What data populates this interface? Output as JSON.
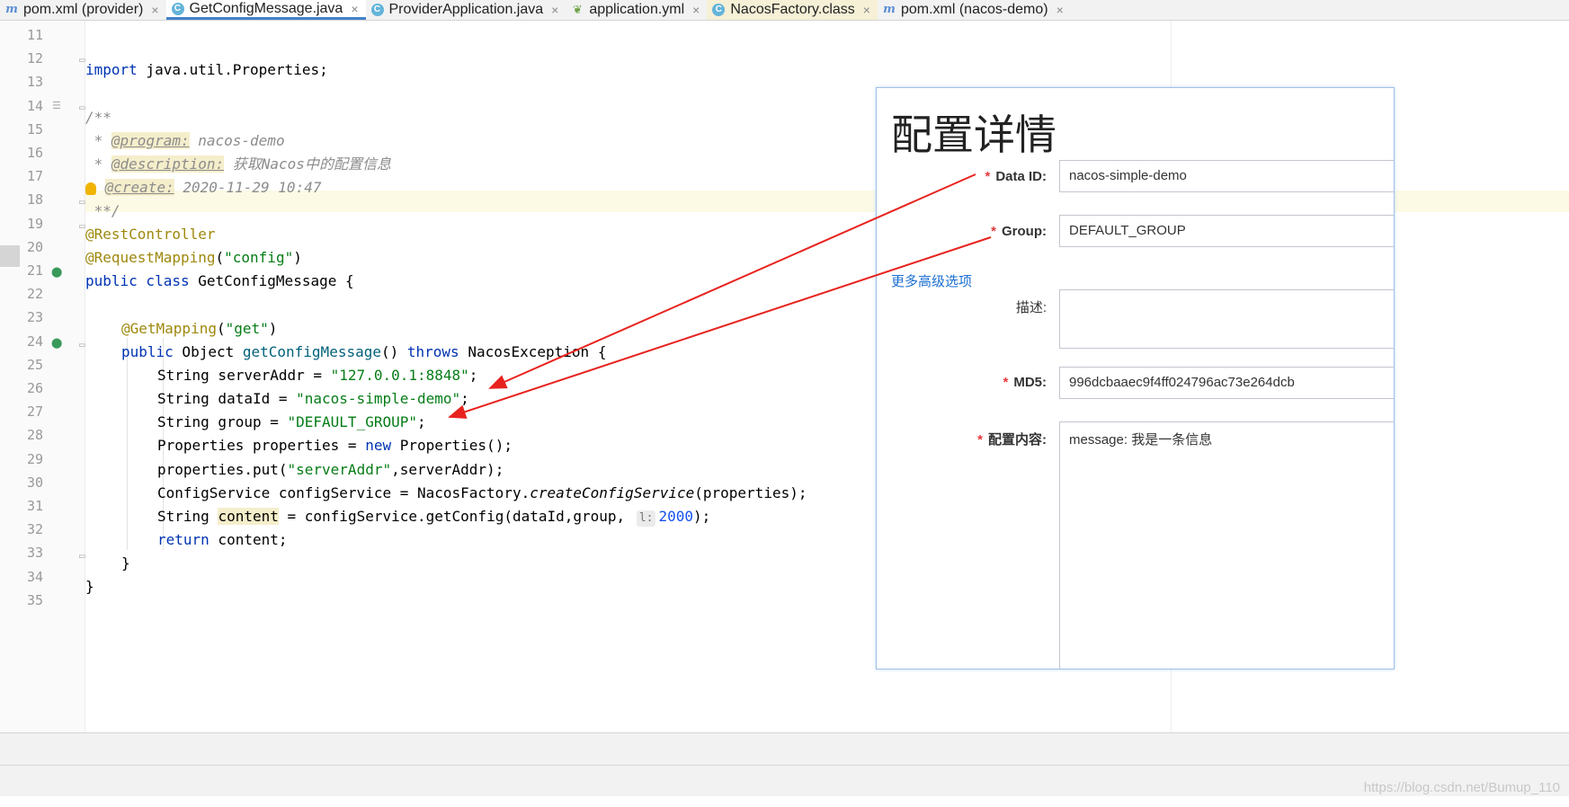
{
  "tabs": [
    {
      "label": "pom.xml (provider)",
      "icon": "maven-icon"
    },
    {
      "label": "GetConfigMessage.java",
      "icon": "class-icon",
      "active": true
    },
    {
      "label": "ProviderApplication.java",
      "icon": "class-icon"
    },
    {
      "label": "application.yml",
      "icon": "yaml-icon"
    },
    {
      "label": "NacosFactory.class",
      "icon": "class-icon",
      "highlighted": true
    },
    {
      "label": "pom.xml (nacos-demo)",
      "icon": "maven-icon"
    }
  ],
  "tab_close_glyph": "×",
  "editor": {
    "line_numbers": [
      "11",
      "12",
      "13",
      "14",
      "15",
      "16",
      "17",
      "18",
      "19",
      "20",
      "21",
      "22",
      "23",
      "24",
      "25",
      "26",
      "27",
      "28",
      "29",
      "30",
      "31",
      "32",
      "33",
      "34",
      "35"
    ],
    "code": {
      "l12_kw": "import",
      "l12_rest": " java.util.Properties;",
      "l14": "/**",
      "l15_star": " * ",
      "l15_tag": "@program:",
      "l15_val": " nacos-demo",
      "l16_star": " * ",
      "l16_tag": "@description:",
      "l16_val": " 获取Nacos中的配置信息",
      "l17_tag": "@create:",
      "l17_val": " 2020-11-29 10:47",
      "l18": " **/",
      "l19": "@RestController",
      "l20_ann": "@RequestMapping",
      "l20_p1": "(",
      "l20_str": "\"config\"",
      "l20_p2": ")",
      "l21_kw": "public class",
      "l21_rest": " GetConfigMessage {",
      "l23_ann": "@GetMapping",
      "l23_p1": "(",
      "l23_str": "\"get\"",
      "l23_p2": ")",
      "l24_kw": "public",
      "l24_a": " Object ",
      "l24_meth": "getConfigMessage",
      "l24_b": "() ",
      "l24_kw2": "throws",
      "l24_c": " NacosException {",
      "l25_a": "String serverAddr = ",
      "l25_str": "\"127.0.0.1:8848\"",
      "l25_b": ";",
      "l26_a": "String dataId = ",
      "l26_str": "\"nacos-simple-demo\"",
      "l26_b": ";",
      "l27_a": "String group = ",
      "l27_str": "\"DEFAULT_GROUP\"",
      "l27_b": ";",
      "l28_a": "Properties properties = ",
      "l28_kw": "new",
      "l28_b": " Properties();",
      "l29_a": "properties.put(",
      "l29_str": "\"serverAddr\"",
      "l29_b": ",serverAddr);",
      "l30_a": "ConfigService configService = NacosFactory.",
      "l30_it": "createConfigService",
      "l30_b": "(properties);",
      "l31_a": "String ",
      "l31_var": "content",
      "l31_b": " = configService.getConfig(dataId,group, ",
      "l31_inlay": "l:",
      "l31_num": "2000",
      "l31_c": ");",
      "l32_kw": "return",
      "l32_rest": " content;",
      "l33": "}",
      "l34": "}"
    }
  },
  "panel": {
    "title": "配置详情",
    "required_mark": "*",
    "fields": {
      "data_id": {
        "label": "Data ID:",
        "value": "nacos-simple-demo"
      },
      "group": {
        "label": "Group:",
        "value": "DEFAULT_GROUP"
      },
      "more": "更多高级选项",
      "desc": {
        "label": "描述:",
        "value": ""
      },
      "md5": {
        "label": "MD5:",
        "value": "996dcbaaec9f4ff024796ac73e264dcb"
      },
      "content": {
        "label": "配置内容:",
        "value": "message: 我是一条信息"
      }
    }
  },
  "annotation_color": "#e8231f",
  "watermark": "https://blog.csdn.net/Bumup_110"
}
